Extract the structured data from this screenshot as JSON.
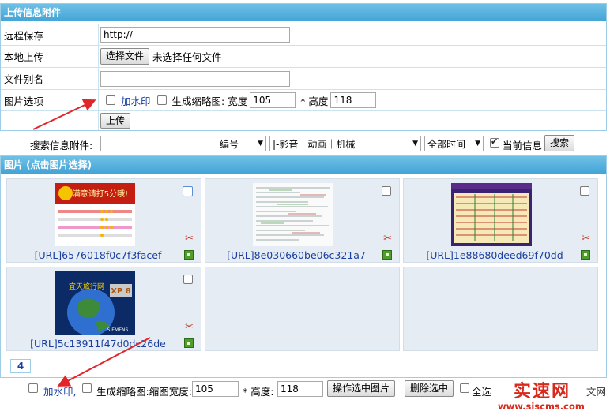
{
  "upload": {
    "header": "上传信息附件",
    "rows": [
      {
        "label": "远程保存",
        "value": "http://"
      },
      {
        "label": "本地上传",
        "button": "选择文件",
        "status": "未选择任何文件"
      },
      {
        "label": "文件别名",
        "value": ""
      },
      {
        "label": "图片选项",
        "watermark": "加水印",
        "thumb": "生成缩略图: 宽度",
        "width": "105",
        "height_label": "* 高度",
        "height": "118"
      }
    ],
    "submit": "上传"
  },
  "search": {
    "label": "搜索信息附件:",
    "value": "",
    "field_select": "编号",
    "category_select": "|-影音｜动画｜机械",
    "time_select": "全部时间",
    "current_checkbox": "当前信息",
    "current_checked": true,
    "button": "搜索"
  },
  "pictures": {
    "header": "图片 (点击图片选择)",
    "items": [
      {
        "caption": "[URL]6576018f0c7f3facef",
        "thumb_text": "满意请打5分哦!"
      },
      {
        "caption": "[URL]8e030660be06c321a7"
      },
      {
        "caption": "[URL]1e88680deed69f70dd"
      },
      {
        "caption": "[URL]5c13911f47d0dc26de",
        "thumb_text": "宜天旅行网",
        "thumb_badge": "XP 8",
        "thumb_brand": "SIEMENS"
      }
    ],
    "page": "4"
  },
  "bottom": {
    "watermark": "加水印,",
    "thumb_label": "生成缩略图:缩图宽度:",
    "width": "105",
    "height_label": "* 高度:",
    "height": "118",
    "apply_button": "操作选中图片",
    "delete_button": "删除选中",
    "select_all": "全选"
  },
  "watermark_logo": {
    "big": "实速网",
    "side": "文网",
    "url": "www.siscms.com"
  },
  "colors": {
    "header_blue": "#43a4d6",
    "link_blue": "#1a3fa0",
    "arrow_red": "#e0262a"
  },
  "icons": [
    "scissors-icon",
    "edit-image-icon",
    "chevron-down-icon",
    "checkbox-icon"
  ]
}
